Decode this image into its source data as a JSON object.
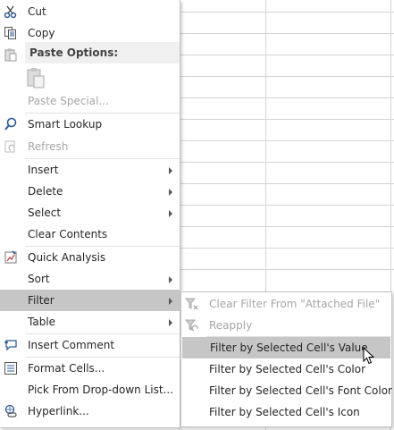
{
  "menu": {
    "cut": "Cut",
    "copy": "Copy",
    "paste_options": "Paste Options:",
    "paste_special": "Paste Special...",
    "smart_lookup": "Smart Lookup",
    "refresh": "Refresh",
    "insert": "Insert",
    "delete": "Delete",
    "select": "Select",
    "clear_contents": "Clear Contents",
    "quick_analysis": "Quick Analysis",
    "sort": "Sort",
    "filter": "Filter",
    "table": "Table",
    "insert_comment": "Insert Comment",
    "format_cells": "Format Cells...",
    "pick_dropdown": "Pick From Drop-down List...",
    "hyperlink": "Hyperlink..."
  },
  "submenu": {
    "clear_filter": "Clear Filter From \"Attached File\"",
    "reapply": "Reapply",
    "by_value": "Filter by Selected Cell's Value",
    "by_color": "Filter by Selected Cell's Color",
    "by_font_color": "Filter by Selected Cell's Font Color",
    "by_icon": "Filter by Selected Cell's Icon"
  },
  "colors": {
    "hover": "#c6c6c6",
    "disabled_text": "#a6a6a6",
    "icon_blue": "#2b579a"
  }
}
